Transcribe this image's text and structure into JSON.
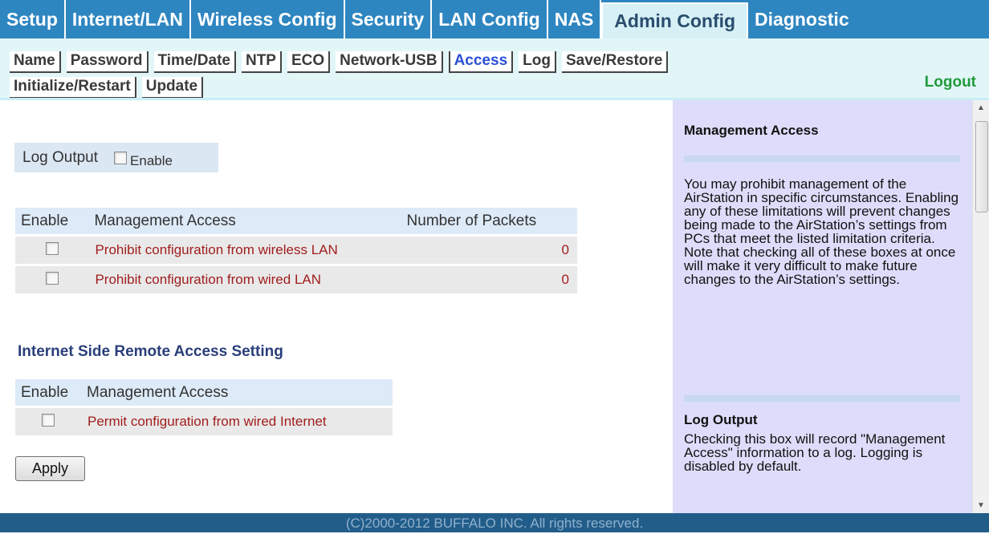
{
  "top_tabs": [
    {
      "label": "Setup"
    },
    {
      "label": "Internet/LAN"
    },
    {
      "label": "Wireless Config"
    },
    {
      "label": "Security"
    },
    {
      "label": "LAN Config"
    },
    {
      "label": "NAS"
    },
    {
      "label": "Admin Config"
    },
    {
      "label": "Diagnostic"
    }
  ],
  "sub_tabs_row1": [
    "Name",
    "Password",
    "Time/Date",
    "NTP",
    "ECO",
    "Network-USB",
    "Access",
    "Log",
    "Save/Restore"
  ],
  "sub_tabs_row2": [
    "Initialize/Restart",
    "Update"
  ],
  "logout_label": "Logout",
  "log_output": {
    "label": "Log Output",
    "checkbox_label": "Enable",
    "checked": false
  },
  "mgmt_table": {
    "headers": [
      "Enable",
      "Management Access",
      "Number of Packets"
    ],
    "rows": [
      {
        "label": "Prohibit configuration from wireless LAN",
        "packets": "0",
        "checked": false
      },
      {
        "label": "Prohibit configuration from wired LAN",
        "packets": "0",
        "checked": false
      }
    ]
  },
  "remote_section": {
    "title": "Internet Side Remote Access Setting",
    "headers": [
      "Enable",
      "Management Access"
    ],
    "rows": [
      {
        "label": "Permit configuration from wired Internet",
        "checked": false
      }
    ]
  },
  "apply_label": "Apply",
  "help": {
    "title1": "Management Access",
    "para1": "You may prohibit management of the AirStation in specific circumstances. Enabling any of these limitations will prevent changes being made to the AirStation’s settings from PCs that meet the listed limitation criteria. Note that checking all of these boxes at once will make it very difficult to make future changes to the AirStation’s settings.",
    "title2": "Log Output",
    "para2": "Checking this box will record \"Management Access\" information to a log. Logging is disabled by default."
  },
  "footer": "(C)2000-2012 BUFFALO INC. All rights reserved.",
  "colors": {
    "nav_blue": "#2e86c1",
    "active_subtab": "#2b4fd6",
    "logout_green": "#1f9a3c",
    "row_text_red": "#a11d1d",
    "footer_blue": "#225d8a"
  }
}
